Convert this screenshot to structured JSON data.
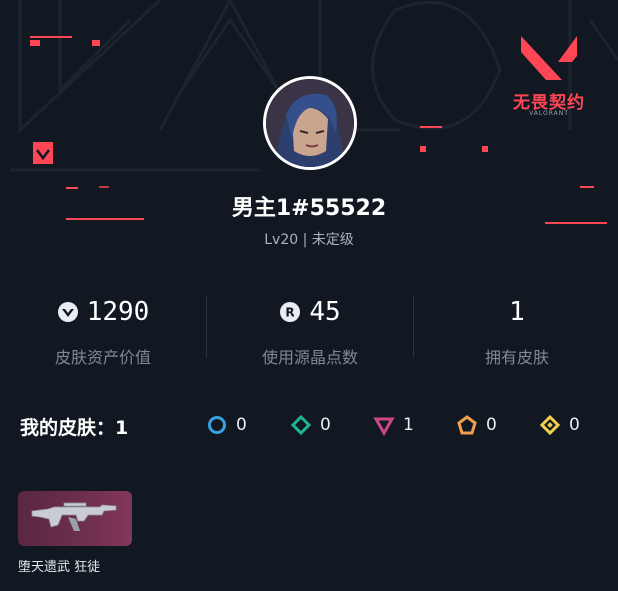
{
  "brand": {
    "name": "无畏契约",
    "sub": "VALORANT",
    "accent": "#ff4655"
  },
  "profile": {
    "username": "男主1#55522",
    "level_text": "Lv20 | 未定级",
    "avatar_icon": "player-avatar-portrait"
  },
  "stats": [
    {
      "icon": "valorant-points-icon",
      "value": "1290",
      "label": "皮肤资产价值"
    },
    {
      "icon": "radianite-points-icon",
      "value": "45",
      "label": "使用源晶点数"
    },
    {
      "icon": "",
      "value": "1",
      "label": "拥有皮肤"
    }
  ],
  "skins": {
    "title": "我的皮肤：1",
    "tiers": [
      {
        "icon": "tier-select-icon",
        "color": "#3aa0e0",
        "count": "0"
      },
      {
        "icon": "tier-deluxe-icon",
        "color": "#1fb58f",
        "count": "0"
      },
      {
        "icon": "tier-premium-icon",
        "color": "#d0468a",
        "count": "1"
      },
      {
        "icon": "tier-exclusive-icon",
        "color": "#f0a04a",
        "count": "0"
      },
      {
        "icon": "tier-ultra-icon",
        "color": "#f2d04d",
        "count": "0"
      }
    ],
    "items": [
      {
        "name": "堕天遗武 狂徒",
        "icon": "rifle-vandal-icon"
      }
    ]
  }
}
